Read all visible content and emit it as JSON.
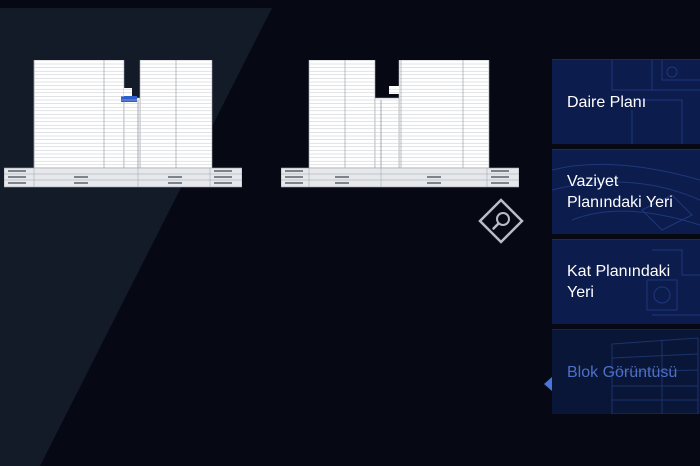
{
  "colors": {
    "background": "#060913",
    "wedge": "#131a28",
    "panel": "#0c1c4d",
    "panel_active": "#0a1637",
    "active_text": "#4d6fc8",
    "highlight": "#2f5fcf",
    "accent_pointer": "#4a74d8"
  },
  "zoom_button": {
    "icon": "magnifier-icon"
  },
  "menu": {
    "items": [
      {
        "label": "Daire Planı",
        "active": false
      },
      {
        "label": "Vaziyet Planındaki Yeri",
        "active": false
      },
      {
        "label": "Kat Planındaki Yeri",
        "active": false
      },
      {
        "label": "Blok Görüntüsü",
        "active": true
      }
    ]
  }
}
